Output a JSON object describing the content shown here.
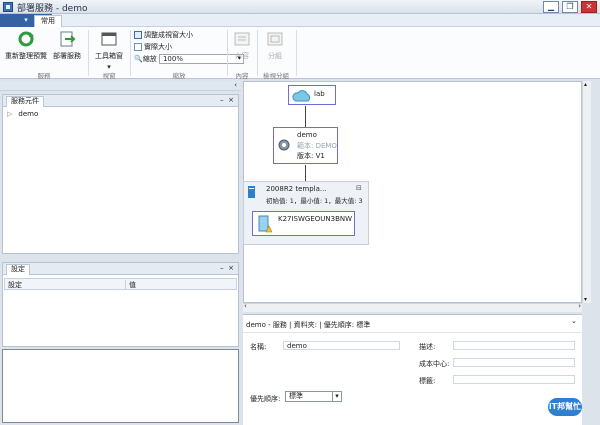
{
  "window": {
    "title": "部署服務 - demo",
    "min": "▁",
    "max": "❐",
    "close": "✕"
  },
  "menu": {
    "file": "▾",
    "tab_home": "常用"
  },
  "ribbon": {
    "refresh_label": "重新整理預覽",
    "deploy_label": "部署服務",
    "toolbox_label": "工具箱窗",
    "fit_window": "調整成視窗大小",
    "actual_size": "實際大小",
    "zoom_label": "縮放",
    "zoom_value": "100%",
    "content_label": "內容",
    "group_label": "分組",
    "groups": {
      "service": "服務",
      "window": "視窗",
      "zoom": "縮放",
      "content": "內容",
      "scale_group": "檢視分組"
    }
  },
  "service_panel": {
    "tab": "服務元件",
    "close": "×",
    "pin": "–",
    "tree": [
      {
        "label": "demo"
      }
    ]
  },
  "settings_panel": {
    "tab": "設定",
    "close": "×",
    "pin": "–",
    "col_setting": "設定",
    "col_value": "值"
  },
  "canvas": {
    "collapse_arrow": "‹",
    "cloud": {
      "name": "lab"
    },
    "service": {
      "name": "demo",
      "release": "範本: DEMO",
      "version": "版本: V1"
    },
    "tier": {
      "name": "2008R2 templa...",
      "counts": "初始值: 1，最小值: 1，最大值: 3",
      "toggle": "⊟"
    },
    "vm": {
      "name": "K27ISWGEOUN3BNW"
    }
  },
  "detail": {
    "header": "demo - 服務 | 資料夾: | 優先順序: 標準",
    "chevron": "⌄",
    "name_label": "名稱:",
    "name_value": "demo",
    "desc_label": "描述:",
    "cost_label": "成本中心:",
    "tag_label": "標籤:",
    "priority_label": "優先順序:",
    "priority_value": "標準"
  },
  "watermark": {
    "text": "iT邦幫忙"
  },
  "colors": {
    "accent": "#3562a5",
    "node_border": "#6c6fd6",
    "selection": "#c7d9f0"
  }
}
